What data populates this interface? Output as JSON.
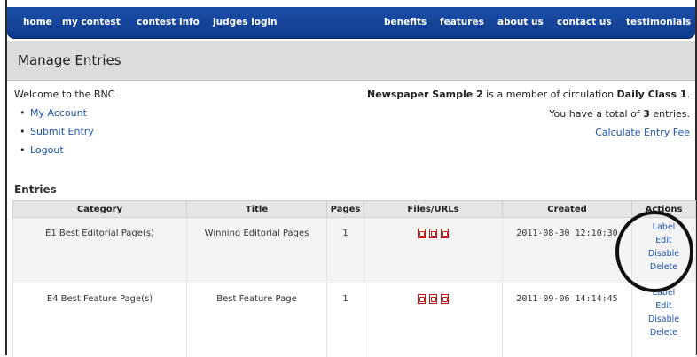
{
  "nav": {
    "items": [
      "home",
      "my contest",
      "contest info",
      "judges login",
      "benefits",
      "features",
      "about us",
      "contact us",
      "testimonials"
    ]
  },
  "page": {
    "title": "Manage Entries",
    "welcome": "Welcome to the BNC",
    "links": [
      "My Account",
      "Submit Entry",
      "Logout"
    ],
    "member": {
      "name": "Newspaper Sample 2",
      "middle": " is a member of circulation ",
      "class": "Daily Class 1",
      "end": "."
    },
    "total": {
      "pre": "You have a total of ",
      "count": "3",
      "post": " entries."
    },
    "calc_link": "Calculate Entry Fee"
  },
  "entries": {
    "heading": "Entries",
    "columns": [
      "Category",
      "Title",
      "Pages",
      "Files/URLs",
      "Created",
      "Actions"
    ],
    "rows": [
      {
        "category": "E1 Best Editorial Page(s)",
        "title": "Winning Editorial Pages",
        "pages": "1",
        "files_icon": "pdf-icon",
        "file_count": 3,
        "created": "2011-08-30 12:10:30",
        "actions": [
          "Label",
          "Edit",
          "Disable",
          "Delete"
        ]
      },
      {
        "category": "E4 Best Feature Page(s)",
        "title": "Best Feature Page",
        "pages": "1",
        "files_icon": "pdf-icon",
        "file_count": 3,
        "created": "2011-09-06 14:14:45",
        "actions": [
          "Label",
          "Edit",
          "Disable",
          "Delete"
        ]
      }
    ]
  },
  "colors": {
    "nav_bg": "#0d3a8c",
    "link": "#1f56b0",
    "header_bg": "#dcdcdc",
    "pdf_red": "#c21818",
    "annotation": "#111111"
  }
}
